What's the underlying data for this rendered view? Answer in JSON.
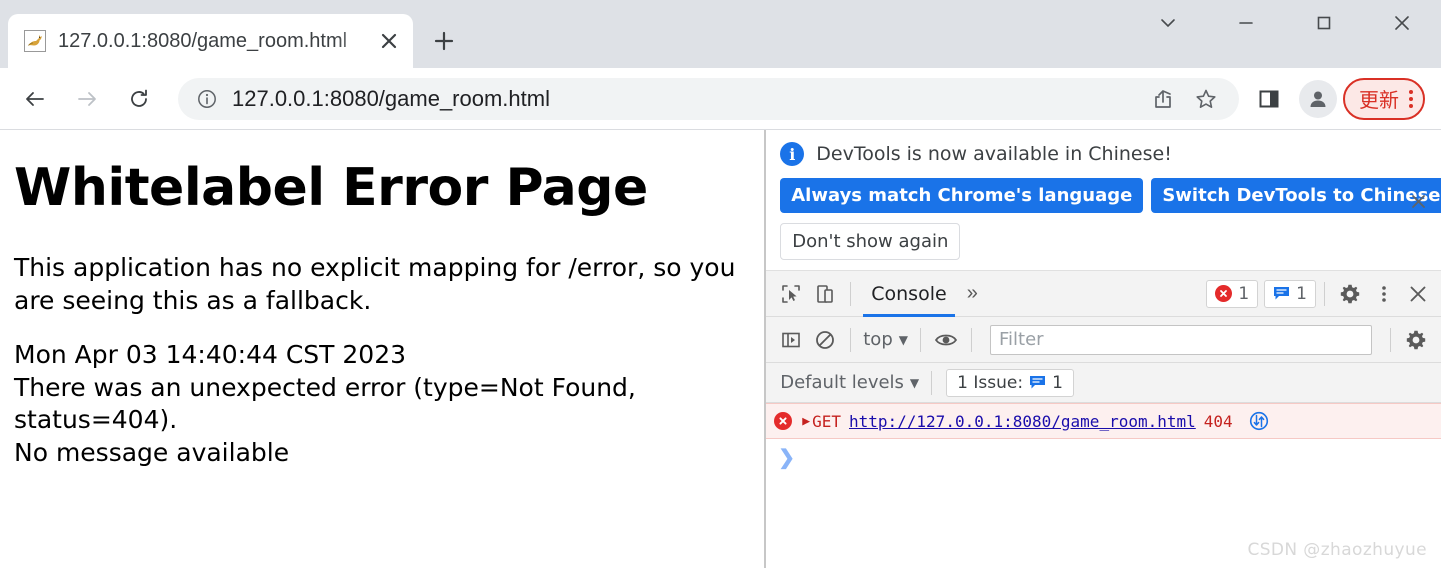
{
  "window": {
    "controls": [
      {
        "name": "tab-search",
        "glyph": "⌄"
      },
      {
        "name": "minimize",
        "glyph": "—"
      },
      {
        "name": "maximize",
        "glyph": "▢"
      },
      {
        "name": "close",
        "glyph": "✕"
      }
    ]
  },
  "tabstrip": {
    "tab_title": "127.0.0.1:8080/game_room.html",
    "favicon": "tomcat-cat-icon",
    "close_label": "✕",
    "newtab_label": "+"
  },
  "toolbar": {
    "back_label": "←",
    "forward_label": "→",
    "reload_label": "⟳",
    "site_info_icon": "info-circle-icon",
    "url": "127.0.0.1:8080/game_room.html",
    "share_icon": "share-icon",
    "bookmark_icon": "star-icon",
    "side_panel_icon": "side-panel-icon",
    "profile_icon": "avatar-icon",
    "update_label": "更新",
    "update_color": "#d93025",
    "menu_icon": "kebab-menu-icon"
  },
  "page": {
    "title": "Whitelabel Error Page",
    "paragraph1": "This application has no explicit mapping for /error, so you are seeing this as a fallback.",
    "detail_lines": [
      "Mon Apr 03 14:40:44 CST 2023",
      "There was an unexpected error (type=Not Found, status=404).",
      "No message available"
    ]
  },
  "devtools": {
    "banner": {
      "info_glyph": "i",
      "message": "DevTools is now available in Chinese!",
      "primary_buttons": [
        "Always match Chrome's language",
        "Switch DevTools to Chinese"
      ],
      "secondary_button": "Don't show again",
      "close_label": "✕",
      "accent": "#1a73e8"
    },
    "tabbar": {
      "inspect_icon": "inspect-element-icon",
      "device_icon": "device-toolbar-icon",
      "tabs": [
        {
          "label": "Console",
          "active": true
        }
      ],
      "overflow_label": "»",
      "error_badge": {
        "icon": "error-circle-icon",
        "count": "1",
        "color": "#e42b2b"
      },
      "message_badge": {
        "icon": "message-bubble-icon",
        "count": "1",
        "color": "#1a73e8"
      },
      "settings_icon": "gear-icon",
      "more_icon": "kebab-menu-icon",
      "close_icon": "close-icon"
    },
    "console_toolbar": {
      "sidebar_icon": "console-sidebar-icon",
      "clear_icon": "clear-console-icon",
      "context": "top",
      "context_caret": "▼",
      "eye_icon": "live-expression-icon",
      "filter_placeholder": "Filter",
      "filter_value": "",
      "settings_icon": "gear-icon"
    },
    "levels_bar": {
      "levels_label": "Default levels",
      "levels_caret": "▼",
      "issues_prefix": "1 Issue:",
      "issues_icon": "message-bubble-icon",
      "issues_count": "1"
    },
    "console": {
      "error_row": {
        "icon": "error-circle-icon",
        "disclosure": "▶",
        "method": "GET",
        "url": "http://127.0.0.1:8080/game_room.html",
        "status": "404",
        "network_icon": "network-request-icon"
      },
      "prompt_glyph": "❯"
    }
  },
  "watermark": "CSDN @zhaozhuyue"
}
